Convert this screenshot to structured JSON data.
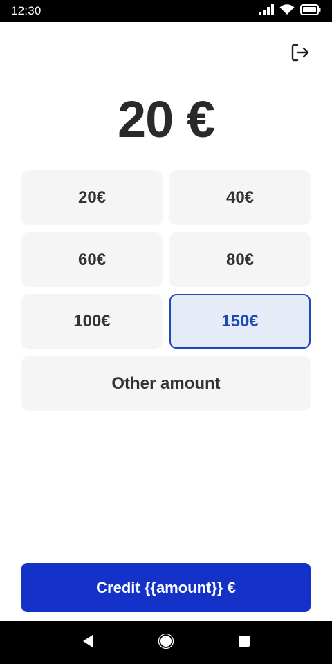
{
  "status_bar": {
    "time": "12:30",
    "icons": [
      "signal-icon",
      "wifi-icon",
      "battery-icon"
    ]
  },
  "header": {
    "logout_icon": "logout-icon"
  },
  "amount": {
    "display": "20 €"
  },
  "options": [
    {
      "label": "20€",
      "selected": false
    },
    {
      "label": "40€",
      "selected": false
    },
    {
      "label": "60€",
      "selected": false
    },
    {
      "label": "80€",
      "selected": false
    },
    {
      "label": "100€",
      "selected": false
    },
    {
      "label": "150€",
      "selected": true
    }
  ],
  "other_amount_label": "Other amount",
  "credit_button_label": "Credit {{amount}} €",
  "nav": {
    "icons": [
      "back-icon",
      "home-icon",
      "recents-icon"
    ]
  },
  "colors": {
    "accent": "#1432c8",
    "selected_border": "#1d49b8",
    "selected_bg": "#e5ecf8",
    "option_bg": "#f5f5f5"
  }
}
